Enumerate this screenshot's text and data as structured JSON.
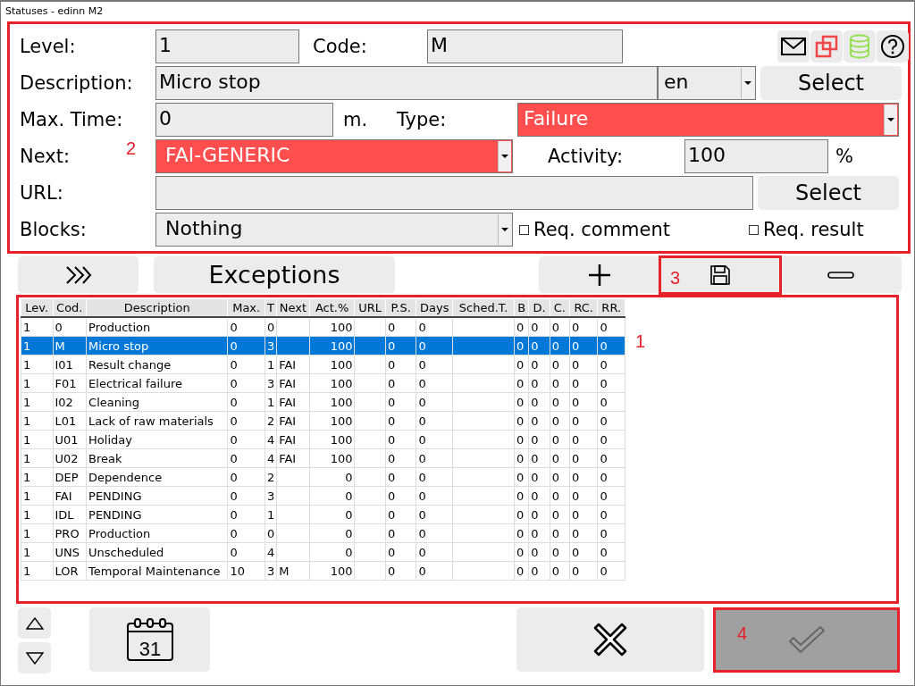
{
  "window": {
    "title": "Statuses - edinn M2"
  },
  "form": {
    "annotation": "2",
    "level": {
      "label": "Level:",
      "value": "1"
    },
    "code": {
      "label": "Code:",
      "value": "M"
    },
    "description": {
      "label": "Description:",
      "value": "Micro stop",
      "language": "en",
      "button": "Select"
    },
    "max_time": {
      "label": "Max. Time:",
      "value": "0",
      "unit": "m."
    },
    "type": {
      "label": "Type:",
      "value": "Failure"
    },
    "next": {
      "label": "Next:",
      "value": "FAI-GENERIC"
    },
    "activity": {
      "label": "Activity:",
      "value": "100",
      "unit": "%"
    },
    "url": {
      "label": "URL:",
      "button": "Select"
    },
    "blocks": {
      "label": "Blocks:",
      "value": "Nothing"
    },
    "checkboxes": [
      {
        "label": "Req. comment",
        "checked": false
      },
      {
        "label": "Req. result",
        "checked": false
      }
    ]
  },
  "toolbar": {
    "exceptions": "Exceptions",
    "save_annotation": "3"
  },
  "table": {
    "annotation": "1",
    "columns": [
      "Lev.",
      "Cod.",
      "Description",
      "Max.",
      "T",
      "Next",
      "Act.%",
      "URL",
      "P.S.",
      "Days",
      "Sched.T.",
      "B",
      "D.",
      "C.",
      "RC.",
      "RR."
    ],
    "rows": [
      {
        "selected": false,
        "cells": [
          "1",
          "0",
          "Production",
          "0",
          "0",
          "",
          "100",
          "",
          "0",
          "0",
          "",
          "0",
          "0",
          "0",
          "0",
          "0"
        ]
      },
      {
        "selected": true,
        "cells": [
          "1",
          "M",
          "Micro stop",
          "0",
          "3",
          "",
          "100",
          "",
          "0",
          "0",
          "",
          "0",
          "0",
          "0",
          "0",
          "0"
        ]
      },
      {
        "selected": false,
        "cells": [
          "1",
          "I01",
          "Result change",
          "0",
          "1",
          "FAI",
          "100",
          "",
          "0",
          "0",
          "",
          "0",
          "0",
          "0",
          "0",
          "0"
        ]
      },
      {
        "selected": false,
        "cells": [
          "1",
          "F01",
          "Electrical failure",
          "0",
          "3",
          "FAI",
          "100",
          "",
          "0",
          "0",
          "",
          "0",
          "0",
          "0",
          "0",
          "0"
        ]
      },
      {
        "selected": false,
        "cells": [
          "1",
          "I02",
          "Cleaning",
          "0",
          "1",
          "FAI",
          "100",
          "",
          "0",
          "0",
          "",
          "0",
          "0",
          "0",
          "0",
          "0"
        ]
      },
      {
        "selected": false,
        "cells": [
          "1",
          "L01",
          "Lack of raw materials",
          "0",
          "2",
          "FAI",
          "100",
          "",
          "0",
          "0",
          "",
          "0",
          "0",
          "0",
          "0",
          "0"
        ]
      },
      {
        "selected": false,
        "cells": [
          "1",
          "U01",
          "Holiday",
          "0",
          "4",
          "FAI",
          "100",
          "",
          "0",
          "0",
          "",
          "0",
          "0",
          "0",
          "0",
          "0"
        ]
      },
      {
        "selected": false,
        "cells": [
          "1",
          "U02",
          "Break",
          "0",
          "4",
          "FAI",
          "100",
          "",
          "0",
          "0",
          "",
          "0",
          "0",
          "0",
          "0",
          "0"
        ]
      },
      {
        "selected": false,
        "cells": [
          "1",
          "DEP",
          "Dependence",
          "0",
          "2",
          "",
          "0",
          "",
          "0",
          "0",
          "",
          "0",
          "0",
          "0",
          "0",
          "0"
        ]
      },
      {
        "selected": false,
        "cells": [
          "1",
          "FAI",
          "PENDING",
          "0",
          "3",
          "",
          "0",
          "",
          "0",
          "0",
          "",
          "0",
          "0",
          "0",
          "0",
          "0"
        ]
      },
      {
        "selected": false,
        "cells": [
          "1",
          "IDL",
          "PENDING",
          "0",
          "1",
          "",
          "0",
          "",
          "0",
          "0",
          "",
          "0",
          "0",
          "0",
          "0",
          "0"
        ]
      },
      {
        "selected": false,
        "cells": [
          "1",
          "PRO",
          "Production",
          "0",
          "0",
          "",
          "0",
          "",
          "0",
          "0",
          "",
          "0",
          "0",
          "0",
          "0",
          "0"
        ]
      },
      {
        "selected": false,
        "cells": [
          "1",
          "UNS",
          "Unscheduled",
          "0",
          "4",
          "",
          "0",
          "",
          "0",
          "0",
          "",
          "0",
          "0",
          "0",
          "0",
          "0"
        ]
      },
      {
        "selected": false,
        "cells": [
          "1",
          "LOR",
          "Temporal Maintenance",
          "10",
          "3",
          "M",
          "100",
          "",
          "0",
          "0",
          "",
          "0",
          "0",
          "0",
          "0",
          "0"
        ]
      }
    ]
  },
  "bottom": {
    "calendar_day": "31",
    "confirm": {
      "disabled": true,
      "annotation": "4"
    }
  }
}
